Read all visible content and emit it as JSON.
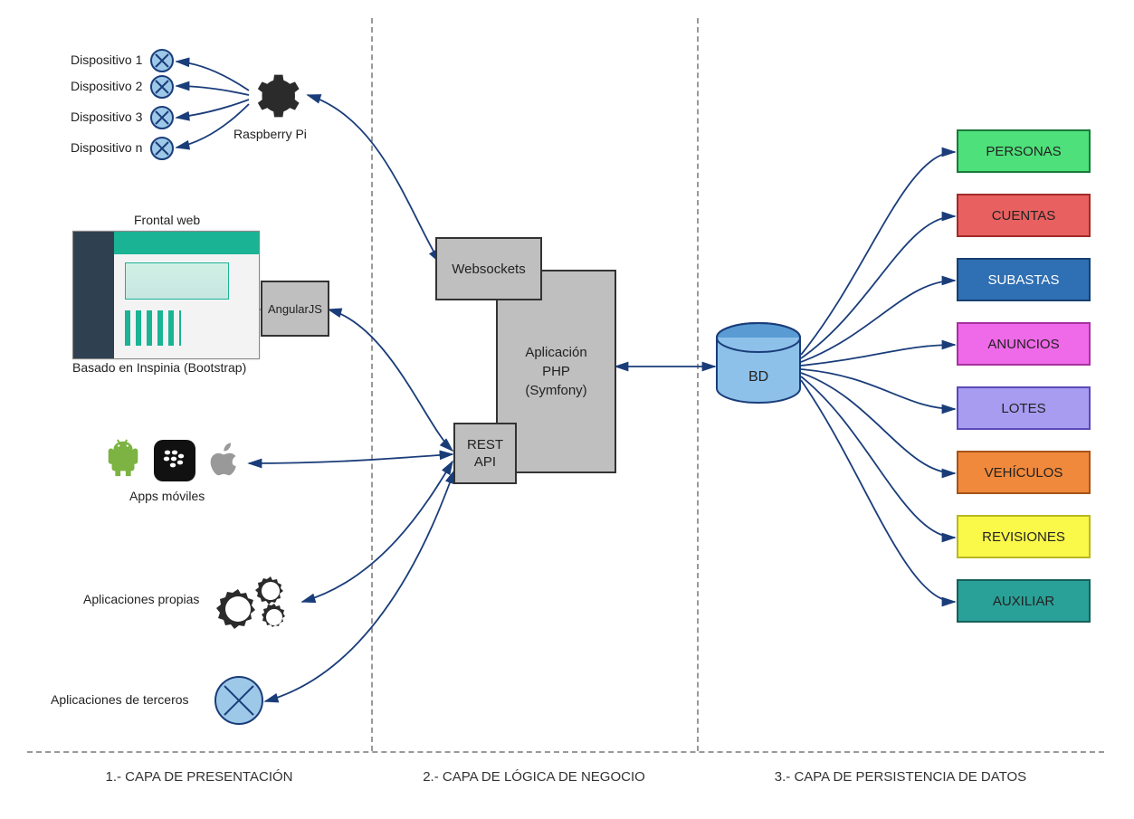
{
  "layers": {
    "presentation": "1.- CAPA DE PRESENTACIÓN",
    "logic": "2.- CAPA DE LÓGICA DE NEGOCIO",
    "persistence": "3.- CAPA DE PERSISTENCIA DE DATOS"
  },
  "devices": {
    "d1": "Dispositivo 1",
    "d2": "Dispositivo 2",
    "d3": "Dispositivo 3",
    "dn": "Dispositivo n"
  },
  "presentation": {
    "raspberry": "Raspberry Pi",
    "frontal": "Frontal web",
    "angular": "AngularJS",
    "inspinia": "Basado en Inspinia (Bootstrap)",
    "appsmoviles": "Apps móviles",
    "propias": "Aplicaciones propias",
    "terceros": "Aplicaciones de terceros"
  },
  "logic": {
    "websockets": "Websockets",
    "php_l1": "Aplicación",
    "php_l2": "PHP",
    "php_l3": "(Symfony)",
    "rest_l1": "REST",
    "rest_l2": "API"
  },
  "db": {
    "label": "BD"
  },
  "tables": {
    "personas": {
      "label": "PERSONAS",
      "fill": "#4ee07a",
      "stroke": "#1a7a3a"
    },
    "cuentas": {
      "label": "CUENTAS",
      "fill": "#e86060",
      "stroke": "#a32a2a"
    },
    "subastas": {
      "label": "SUBASTAS",
      "fill": "#2f6fb3",
      "stroke": "#17406e",
      "color": "#fff"
    },
    "anuncios": {
      "label": "ANUNCIOS",
      "fill": "#ef6ae8",
      "stroke": "#a831a1"
    },
    "lotes": {
      "label": "LOTES",
      "fill": "#a89cf0",
      "stroke": "#5a49b8"
    },
    "vehiculos": {
      "label": "VEHÍCULOS",
      "fill": "#f0893c",
      "stroke": "#a6531a"
    },
    "revisiones": {
      "label": "REVISIONES",
      "fill": "#faf94a",
      "stroke": "#b8b820"
    },
    "auxiliar": {
      "label": "AUXILIAR",
      "fill": "#2aa198",
      "stroke": "#17605a"
    }
  }
}
